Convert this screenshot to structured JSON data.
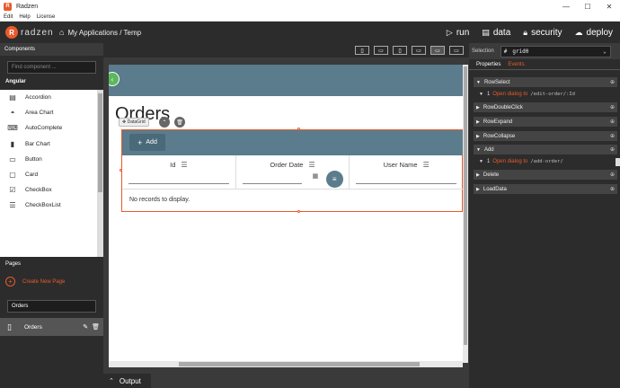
{
  "window": {
    "title": "Radzen",
    "controls": {
      "minimize": "—",
      "maximize": "☐",
      "close": "✕"
    }
  },
  "menu": [
    "Edit",
    "Help",
    "License"
  ],
  "header": {
    "logo_text": "radzen",
    "breadcrumb": "My Applications / Temp",
    "actions": [
      {
        "label": "run",
        "icon": "play-icon"
      },
      {
        "label": "data",
        "icon": "database-icon"
      },
      {
        "label": "security",
        "icon": "lock-icon"
      },
      {
        "label": "deploy",
        "icon": "cloud-upload-icon"
      }
    ]
  },
  "left": {
    "section_title": "Components",
    "search_placeholder": "Find component ...",
    "group": "Angular",
    "components": [
      {
        "label": "Accordion",
        "icon": "▤"
      },
      {
        "label": "Area Chart",
        "icon": "◓"
      },
      {
        "label": "AutoComplete",
        "icon": "⌨"
      },
      {
        "label": "Bar Chart",
        "icon": "▮"
      },
      {
        "label": "Button",
        "icon": "▭"
      },
      {
        "label": "Card",
        "icon": "▢"
      },
      {
        "label": "CheckBox",
        "icon": "☑"
      },
      {
        "label": "CheckBoxList",
        "icon": "☰"
      }
    ],
    "pages_title": "Pages",
    "create_label": "Create New Page",
    "page_search_value": "Orders",
    "pages": [
      {
        "label": "Orders"
      }
    ]
  },
  "canvas": {
    "page_title": "Orders",
    "chip_label": "DataGrid",
    "add_label": "Add",
    "columns": [
      "Id",
      "Order Date",
      "User Name"
    ],
    "empty_text": "No records to display."
  },
  "output_label": "Output",
  "right": {
    "selection_label": "Selection",
    "selection_value": "grid0",
    "tabs": [
      "Properties",
      "Events"
    ],
    "events": [
      {
        "name": "RowSelect",
        "expanded": true,
        "items": [
          {
            "n": "1",
            "action": "Open dialog to",
            "path": "/edit-order/:Id"
          }
        ]
      },
      {
        "name": "RowDoubleClick",
        "expanded": false,
        "items": []
      },
      {
        "name": "RowExpand",
        "expanded": false,
        "items": []
      },
      {
        "name": "RowCollapse",
        "expanded": false,
        "items": []
      },
      {
        "name": "Add",
        "expanded": true,
        "items": [
          {
            "n": "1",
            "action": "Open dialog to",
            "path": "/add-order/"
          }
        ]
      },
      {
        "name": "Delete",
        "expanded": false,
        "items": []
      },
      {
        "name": "LoadData",
        "expanded": false,
        "items": []
      }
    ]
  },
  "colors": {
    "accent": "#e95a2b",
    "header": "#5b7c8c",
    "dark": "#2c2c2c"
  }
}
